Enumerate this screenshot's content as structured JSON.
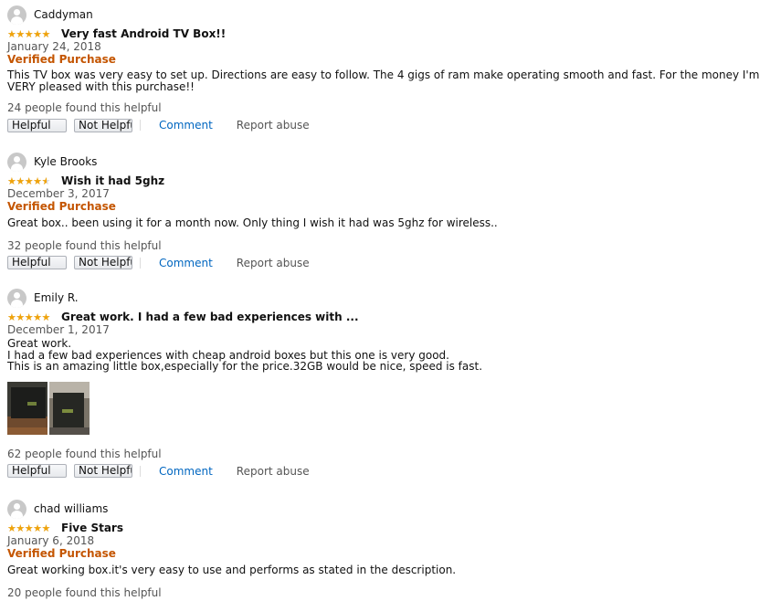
{
  "reviews": [
    {
      "name": "Caddyman",
      "rating": 5,
      "title": "Very fast Android TV Box!!",
      "date": "January 24, 2018",
      "verified": "Verified Purchase",
      "body": [
        "This TV box was very easy to set up. Directions are easy to follow. The 4 gigs of ram make operating smooth and fast. For the money I'm VERY pleased with this purchase!!"
      ],
      "helpful": "24 people found this helpful",
      "helpful_btn": "Helpful",
      "not_helpful_btn": "Not Helpful",
      "comment": "Comment",
      "report": "Report abuse"
    },
    {
      "name": "Kyle Brooks",
      "rating": 4,
      "title": "Wish it had 5ghz",
      "date": "December 3, 2017",
      "verified": "Verified Purchase",
      "body": [
        "Great box.. been using it for a month now. Only thing I wish it had was 5ghz for wireless.."
      ],
      "helpful": "32 people found this helpful",
      "helpful_btn": "Helpful",
      "not_helpful_btn": "Not Helpful",
      "comment": "Comment",
      "report": "Report abuse"
    },
    {
      "name": "Emily R.",
      "rating": 5,
      "title": "Great work. I had a few bad experiences with ...",
      "date": "December 1, 2017",
      "verified": "",
      "body": [
        "Great work.",
        "I had a few bad experiences with cheap android boxes but this one is very good.",
        "This is an amazing little box,especially for the price.32GB would be nice, speed is fast."
      ],
      "helpful": "62 people found this helpful",
      "helpful_btn": "Helpful",
      "not_helpful_btn": "Not Helpful",
      "comment": "Comment",
      "report": "Report abuse",
      "photo_count": 2
    },
    {
      "name": "chad williams",
      "rating": 5,
      "title": "Five Stars",
      "date": "January 6, 2018",
      "verified": "Verified Purchase",
      "body": [
        "Great working box.it's very easy to use and performs as stated in the description."
      ],
      "helpful": "20 people found this helpful"
    }
  ],
  "colors": {
    "star": "#f0a30a",
    "verified": "#c45500",
    "link": "#0066c0",
    "muted": "#555555"
  },
  "icons": {
    "avatar": "user-silhouette-icon",
    "star": "star-icon"
  }
}
